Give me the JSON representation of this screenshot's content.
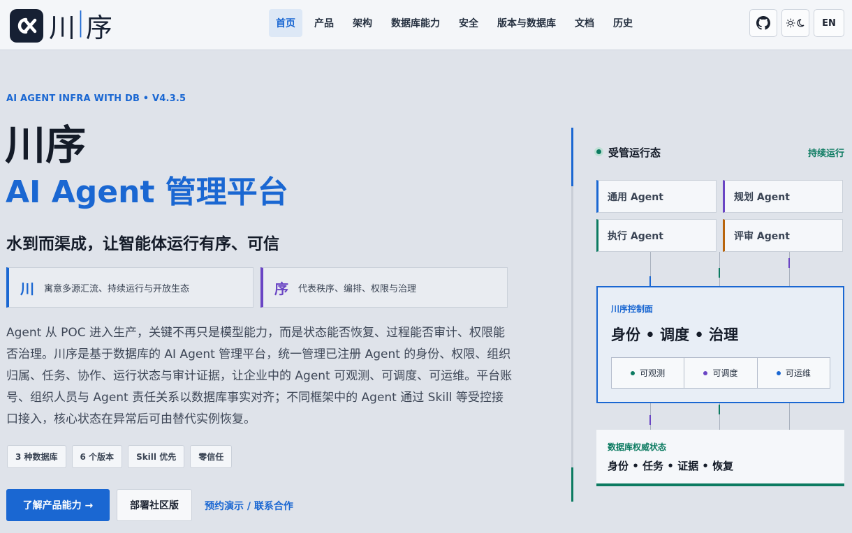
{
  "colors": {
    "accent": "#1a67d2",
    "green": "#0c7b61",
    "purple": "#6a45c4",
    "orange": "#b8640c",
    "dark": "#141b28"
  },
  "header": {
    "logo_text": "川",
    "logo_accent": "|",
    "logo_text2": "序",
    "nav": [
      {
        "label": "首页",
        "active": true
      },
      {
        "label": "产品"
      },
      {
        "label": "架构"
      },
      {
        "label": "数据库能力"
      },
      {
        "label": "安全"
      },
      {
        "label": "版本与数据库"
      },
      {
        "label": "文档"
      },
      {
        "label": "历史"
      }
    ],
    "github_icon": "github-icon",
    "theme_icon": "theme-toggle-icon",
    "lang_label": "EN"
  },
  "hero": {
    "eyebrow": "AI AGENT INFRA WITH DB  •  V4.3.5",
    "title": "川序",
    "subtitle": "AI Agent 管理平台",
    "tagline": "水到而渠成，让智能体运行有序、可信",
    "meanings": [
      {
        "glyph": "川",
        "text": "寓意多源汇流、持续运行与开放生态"
      },
      {
        "glyph": "序",
        "text": "代表秩序、编排、权限与治理"
      }
    ],
    "description": "Agent 从 POC 进入生产，关键不再只是模型能力，而是状态能否恢复、过程能否审计、权限能否治理。川序是基于数据库的 AI Agent 管理平台，统一管理已注册 Agent 的身份、权限、组织归属、任务、协作、运行状态与审计证据，让企业中的 Agent 可观测、可调度、可运维。平台账号、组织人员与 Agent 责任关系以数据库事实对齐；不同框架中的 Agent 通过 Skill 等受控接口接入，核心状态在异常后可由替代实例恢复。",
    "chips": [
      "3 种数据库",
      "6 个版本",
      "Skill 优先",
      "零信任"
    ],
    "cta_primary": "了解产品能力  →",
    "cta_secondary": "部署社区版",
    "cta_link": "预约演示 / 联系合作"
  },
  "panel": {
    "status_title": "受管运行态",
    "status_right": "持续运行",
    "agents": [
      "通用 Agent",
      "规划 Agent",
      "执行 Agent",
      "评审 Agent"
    ],
    "control_label": "川序控制面",
    "control_title": "身份  •  调度  •  治理",
    "pills": [
      "可观测",
      "可调度",
      "可运维"
    ],
    "db_label": "数据库权威状态",
    "db_title": "身份  •  任务  •  证据  •  恢复"
  }
}
